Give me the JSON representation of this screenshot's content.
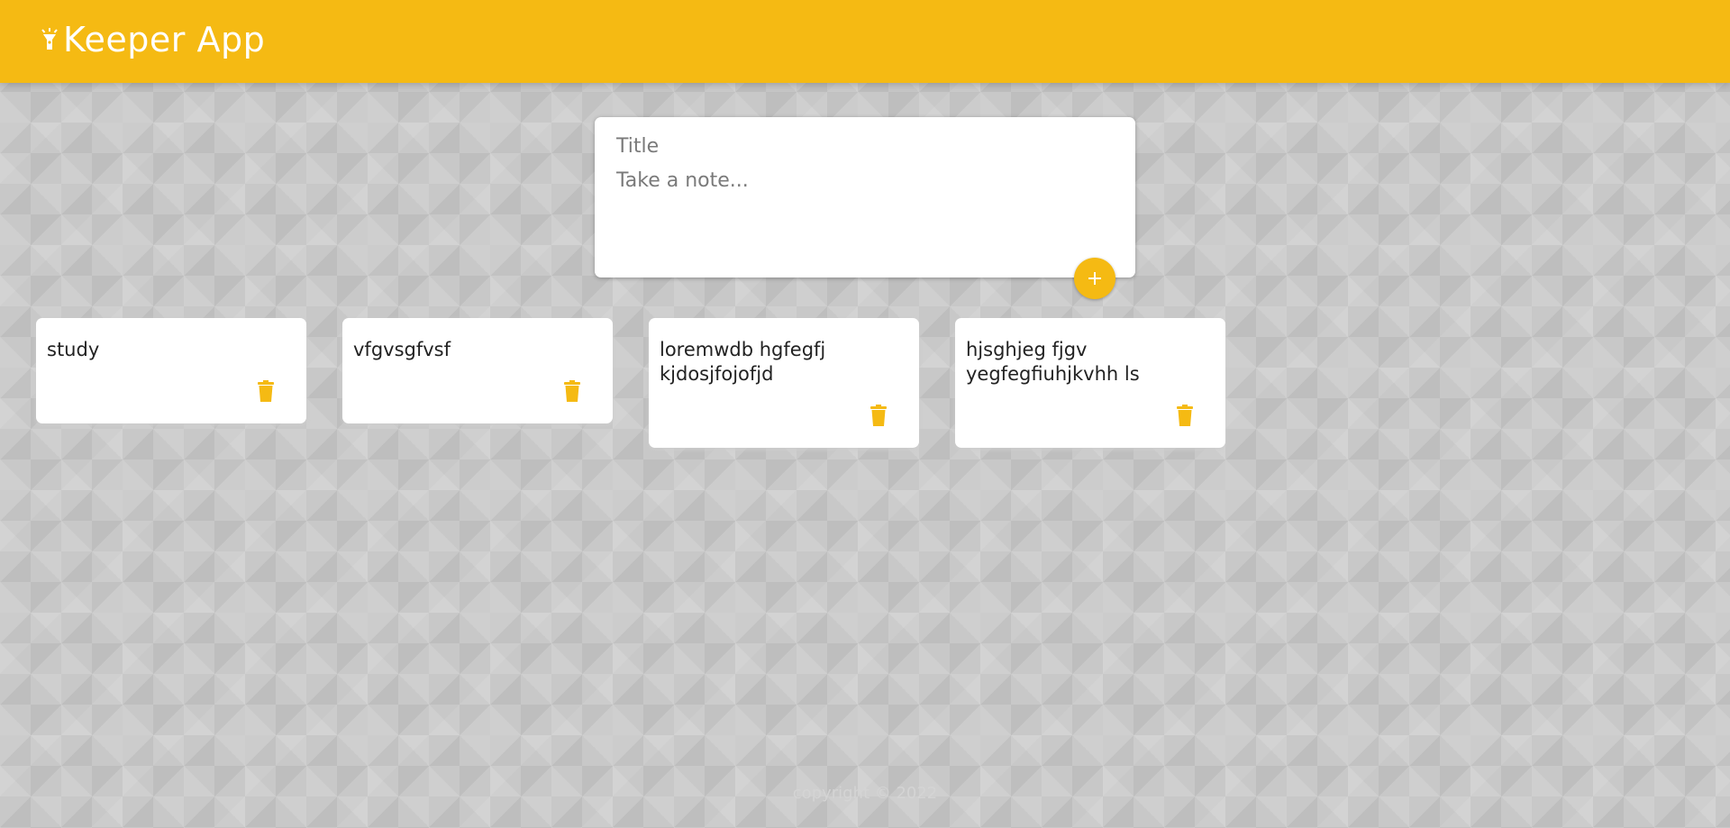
{
  "header": {
    "title": "Keeper App",
    "logo_icon": "highlight-icon",
    "color": "#f5ba13"
  },
  "create_area": {
    "title_placeholder": "Title",
    "content_placeholder": "Take a note...",
    "add_icon": "plus-icon"
  },
  "notes": [
    {
      "content": "study",
      "delete_icon": "trash-icon"
    },
    {
      "content": "vfgvsgfvsf",
      "delete_icon": "trash-icon"
    },
    {
      "content": "loremwdb hgfegfj kjdosjfojofjd",
      "delete_icon": "trash-icon"
    },
    {
      "content": "hjsghjeg fjgv yegfegfiuhjkvhh ls",
      "delete_icon": "trash-icon"
    }
  ],
  "footer": {
    "text": "copyright © 2022"
  },
  "colors": {
    "accent": "#f5ba13",
    "background": "#c8c8c8"
  }
}
